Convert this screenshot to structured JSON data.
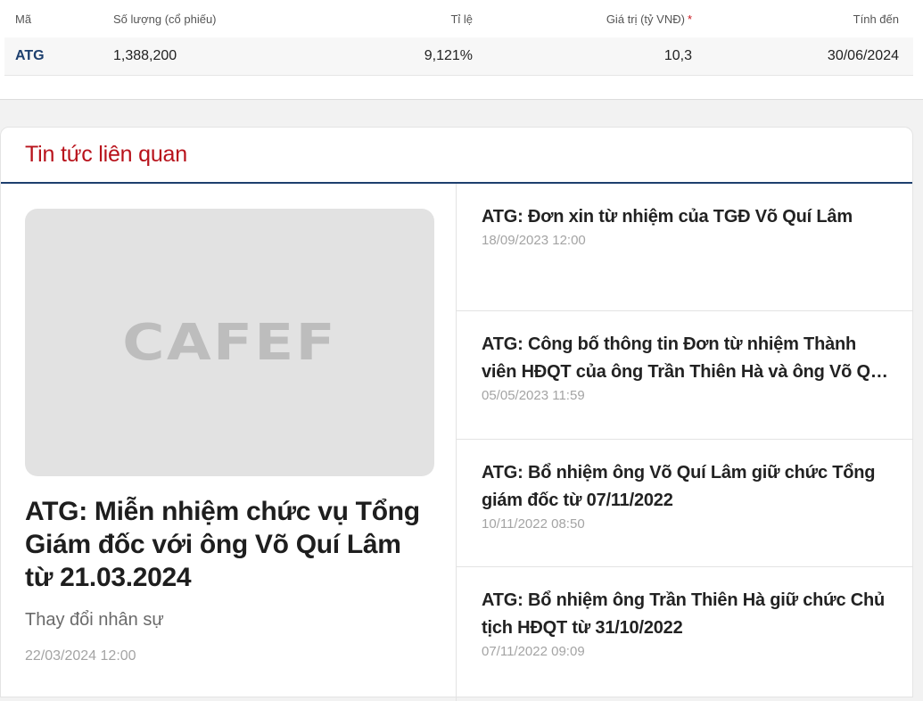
{
  "holding": {
    "headers": {
      "code": "Mã",
      "quantity": "Số lượng (cổ phiếu)",
      "ratio": "Tỉ lệ",
      "value": "Giá trị (tỷ VNĐ)",
      "value_marker": "*",
      "as_of": "Tính đến"
    },
    "row": {
      "code": "ATG",
      "quantity": "1,388,200",
      "ratio": "9,121%",
      "value": "10,3",
      "as_of": "30/06/2024"
    }
  },
  "news": {
    "section_title": "Tin tức liên quan",
    "featured": {
      "image_logo": "CAFEF",
      "title": "ATG: Miễn nhiệm chức vụ Tổng Giám đốc với ông Võ Quí Lâm từ 21.03.2024",
      "category": "Thay đổi nhân sự",
      "date": "22/03/2024 12:00"
    },
    "items": [
      {
        "title": "ATG: Đơn xin từ nhiệm của TGĐ Võ Quí Lâm",
        "date": "18/09/2023 12:00"
      },
      {
        "title": "ATG: Công bố thông tin Đơn từ nhiệm Thành viên HĐQT của ông Trần Thiên Hà và ông Võ Quí Lâm",
        "date": "05/05/2023 11:59"
      },
      {
        "title": "ATG: Bổ nhiệm ông Võ Quí Lâm giữ chức Tổng giám đốc từ 07/11/2022",
        "date": "10/11/2022 08:50"
      },
      {
        "title": "ATG: Bổ nhiệm ông Trần Thiên Hà giữ chức Chủ tịch HĐQT từ 31/10/2022",
        "date": "07/11/2022 09:09"
      }
    ]
  },
  "colors": {
    "accent_red": "#b8121b",
    "navy": "#1d3f6e"
  }
}
